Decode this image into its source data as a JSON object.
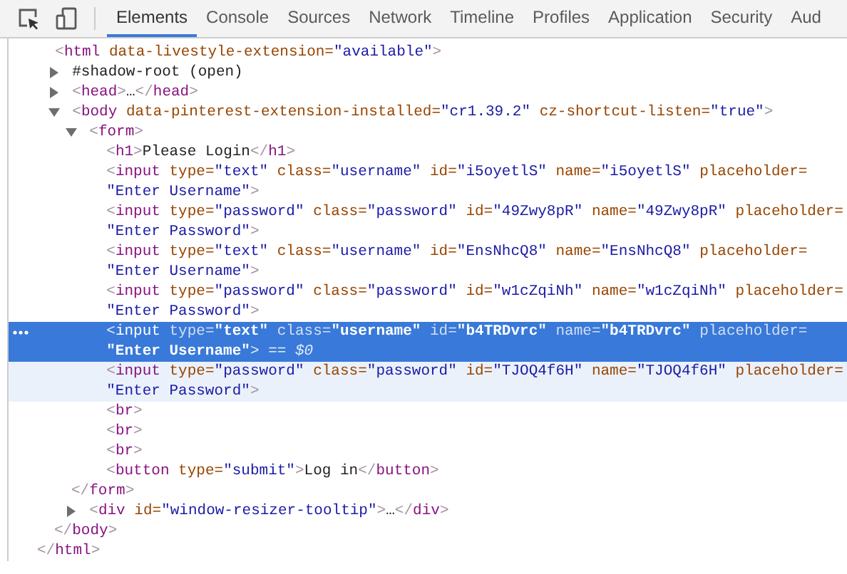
{
  "tabs": [
    {
      "label": "Elements",
      "selected": true
    },
    {
      "label": "Console",
      "selected": false
    },
    {
      "label": "Sources",
      "selected": false
    },
    {
      "label": "Network",
      "selected": false
    },
    {
      "label": "Timeline",
      "selected": false
    },
    {
      "label": "Profiles",
      "selected": false
    },
    {
      "label": "Application",
      "selected": false
    },
    {
      "label": "Security",
      "selected": false
    },
    {
      "label": "Aud",
      "selected": false
    }
  ],
  "tree": [
    {
      "selected": false,
      "hovered": false,
      "lines": [
        [
          {
            "kind": "punct",
            "text": "<"
          },
          {
            "kind": "tag",
            "text": "html"
          },
          {
            "kind": "attr",
            "text": " data-livestyle-extension="
          },
          {
            "kind": "value",
            "text": "\"available\""
          },
          {
            "kind": "punct",
            "text": ">"
          }
        ]
      ],
      "close": [
        {
          "kind": "punct",
          "text": "</"
        },
        {
          "kind": "tag",
          "text": "html"
        },
        {
          "kind": "punct",
          "text": ">"
        }
      ],
      "children": [
        {
          "selected": false,
          "hovered": false,
          "expanded": false,
          "lines": [
            [
              {
                "kind": "text",
                "text": "#shadow-root (open)"
              }
            ]
          ]
        },
        {
          "selected": false,
          "hovered": false,
          "expanded": false,
          "lines": [
            [
              {
                "kind": "punct",
                "text": "<"
              },
              {
                "kind": "tag",
                "text": "head"
              },
              {
                "kind": "punct",
                "text": ">"
              },
              {
                "kind": "text",
                "text": "…"
              },
              {
                "kind": "punct",
                "text": "</"
              },
              {
                "kind": "tag",
                "text": "head"
              },
              {
                "kind": "punct",
                "text": ">"
              }
            ]
          ]
        },
        {
          "selected": false,
          "hovered": false,
          "expanded": true,
          "lines": [
            [
              {
                "kind": "punct",
                "text": "<"
              },
              {
                "kind": "tag",
                "text": "body"
              },
              {
                "kind": "attr",
                "text": " data-pinterest-extension-installed="
              },
              {
                "kind": "value",
                "text": "\"cr1.39.2\""
              },
              {
                "kind": "attr",
                "text": " cz-shortcut-listen="
              },
              {
                "kind": "value",
                "text": "\"true\""
              },
              {
                "kind": "punct",
                "text": ">"
              }
            ]
          ],
          "close": [
            {
              "kind": "punct",
              "text": "</"
            },
            {
              "kind": "tag",
              "text": "body"
            },
            {
              "kind": "punct",
              "text": ">"
            }
          ],
          "children": [
            {
              "selected": false,
              "hovered": false,
              "expanded": true,
              "lines": [
                [
                  {
                    "kind": "punct",
                    "text": "<"
                  },
                  {
                    "kind": "tag",
                    "text": "form"
                  },
                  {
                    "kind": "punct",
                    "text": ">"
                  }
                ]
              ],
              "close": [
                {
                  "kind": "punct",
                  "text": "</"
                },
                {
                  "kind": "tag",
                  "text": "form"
                },
                {
                  "kind": "punct",
                  "text": ">"
                }
              ],
              "children": [
                {
                  "selected": false,
                  "hovered": false,
                  "lines": [
                    [
                      {
                        "kind": "punct",
                        "text": "<"
                      },
                      {
                        "kind": "tag",
                        "text": "h1"
                      },
                      {
                        "kind": "punct",
                        "text": ">"
                      },
                      {
                        "kind": "text",
                        "text": "Please Login"
                      },
                      {
                        "kind": "punct",
                        "text": "</"
                      },
                      {
                        "kind": "tag",
                        "text": "h1"
                      },
                      {
                        "kind": "punct",
                        "text": ">"
                      }
                    ]
                  ]
                },
                {
                  "selected": false,
                  "hovered": false,
                  "lines": [
                    [
                      {
                        "kind": "punct",
                        "text": "<"
                      },
                      {
                        "kind": "tag",
                        "text": "input"
                      },
                      {
                        "kind": "attr",
                        "text": " type="
                      },
                      {
                        "kind": "value",
                        "text": "\"text\""
                      },
                      {
                        "kind": "attr",
                        "text": " class="
                      },
                      {
                        "kind": "value",
                        "text": "\"username\""
                      },
                      {
                        "kind": "attr",
                        "text": " id="
                      },
                      {
                        "kind": "value",
                        "text": "\"i5oyetlS\""
                      },
                      {
                        "kind": "attr",
                        "text": " name="
                      },
                      {
                        "kind": "value",
                        "text": "\"i5oyetlS\""
                      },
                      {
                        "kind": "attr",
                        "text": " placeholder="
                      }
                    ],
                    [
                      {
                        "kind": "value",
                        "text": "\"Enter Username\""
                      },
                      {
                        "kind": "punct",
                        "text": ">"
                      }
                    ]
                  ]
                },
                {
                  "selected": false,
                  "hovered": false,
                  "lines": [
                    [
                      {
                        "kind": "punct",
                        "text": "<"
                      },
                      {
                        "kind": "tag",
                        "text": "input"
                      },
                      {
                        "kind": "attr",
                        "text": " type="
                      },
                      {
                        "kind": "value",
                        "text": "\"password\""
                      },
                      {
                        "kind": "attr",
                        "text": " class="
                      },
                      {
                        "kind": "value",
                        "text": "\"password\""
                      },
                      {
                        "kind": "attr",
                        "text": " id="
                      },
                      {
                        "kind": "value",
                        "text": "\"49Zwy8pR\""
                      },
                      {
                        "kind": "attr",
                        "text": " name="
                      },
                      {
                        "kind": "value",
                        "text": "\"49Zwy8pR\""
                      },
                      {
                        "kind": "attr",
                        "text": " placeholder="
                      }
                    ],
                    [
                      {
                        "kind": "value",
                        "text": "\"Enter Password\""
                      },
                      {
                        "kind": "punct",
                        "text": ">"
                      }
                    ]
                  ]
                },
                {
                  "selected": false,
                  "hovered": false,
                  "lines": [
                    [
                      {
                        "kind": "punct",
                        "text": "<"
                      },
                      {
                        "kind": "tag",
                        "text": "input"
                      },
                      {
                        "kind": "attr",
                        "text": " type="
                      },
                      {
                        "kind": "value",
                        "text": "\"text\""
                      },
                      {
                        "kind": "attr",
                        "text": " class="
                      },
                      {
                        "kind": "value",
                        "text": "\"username\""
                      },
                      {
                        "kind": "attr",
                        "text": " id="
                      },
                      {
                        "kind": "value",
                        "text": "\"EnsNhcQ8\""
                      },
                      {
                        "kind": "attr",
                        "text": " name="
                      },
                      {
                        "kind": "value",
                        "text": "\"EnsNhcQ8\""
                      },
                      {
                        "kind": "attr",
                        "text": " placeholder="
                      }
                    ],
                    [
                      {
                        "kind": "value",
                        "text": "\"Enter Username\""
                      },
                      {
                        "kind": "punct",
                        "text": ">"
                      }
                    ]
                  ]
                },
                {
                  "selected": false,
                  "hovered": false,
                  "lines": [
                    [
                      {
                        "kind": "punct",
                        "text": "<"
                      },
                      {
                        "kind": "tag",
                        "text": "input"
                      },
                      {
                        "kind": "attr",
                        "text": " type="
                      },
                      {
                        "kind": "value",
                        "text": "\"password\""
                      },
                      {
                        "kind": "attr",
                        "text": " class="
                      },
                      {
                        "kind": "value",
                        "text": "\"password\""
                      },
                      {
                        "kind": "attr",
                        "text": " id="
                      },
                      {
                        "kind": "value",
                        "text": "\"w1cZqiNh\""
                      },
                      {
                        "kind": "attr",
                        "text": " name="
                      },
                      {
                        "kind": "value",
                        "text": "\"w1cZqiNh\""
                      },
                      {
                        "kind": "attr",
                        "text": " placeholder="
                      }
                    ],
                    [
                      {
                        "kind": "value",
                        "text": "\"Enter Password\""
                      },
                      {
                        "kind": "punct",
                        "text": ">"
                      }
                    ]
                  ]
                },
                {
                  "selected": true,
                  "hovered": false,
                  "lines": [
                    [
                      {
                        "kind": "punct",
                        "text": "<"
                      },
                      {
                        "kind": "tag",
                        "text": "input"
                      },
                      {
                        "kind": "attr",
                        "text": " type="
                      },
                      {
                        "kind": "value",
                        "text": "\"text\""
                      },
                      {
                        "kind": "attr",
                        "text": " class="
                      },
                      {
                        "kind": "value",
                        "text": "\"username\""
                      },
                      {
                        "kind": "attr",
                        "text": " id="
                      },
                      {
                        "kind": "value",
                        "text": "\"b4TRDvrc\""
                      },
                      {
                        "kind": "attr",
                        "text": " name="
                      },
                      {
                        "kind": "value",
                        "text": "\"b4TRDvrc\""
                      },
                      {
                        "kind": "attr",
                        "text": " placeholder="
                      }
                    ],
                    [
                      {
                        "kind": "value",
                        "text": "\"Enter Username\""
                      },
                      {
                        "kind": "punct",
                        "text": ">"
                      },
                      {
                        "kind": "console",
                        "text": " == $0"
                      }
                    ]
                  ]
                },
                {
                  "selected": false,
                  "hovered": true,
                  "lines": [
                    [
                      {
                        "kind": "punct",
                        "text": "<"
                      },
                      {
                        "kind": "tag",
                        "text": "input"
                      },
                      {
                        "kind": "attr",
                        "text": " type="
                      },
                      {
                        "kind": "value",
                        "text": "\"password\""
                      },
                      {
                        "kind": "attr",
                        "text": " class="
                      },
                      {
                        "kind": "value",
                        "text": "\"password\""
                      },
                      {
                        "kind": "attr",
                        "text": " id="
                      },
                      {
                        "kind": "value",
                        "text": "\"TJOQ4f6H\""
                      },
                      {
                        "kind": "attr",
                        "text": " name="
                      },
                      {
                        "kind": "value",
                        "text": "\"TJOQ4f6H\""
                      },
                      {
                        "kind": "attr",
                        "text": " placeholder="
                      }
                    ],
                    [
                      {
                        "kind": "value",
                        "text": "\"Enter Password\""
                      },
                      {
                        "kind": "punct",
                        "text": ">"
                      }
                    ]
                  ]
                },
                {
                  "selected": false,
                  "hovered": false,
                  "lines": [
                    [
                      {
                        "kind": "punct",
                        "text": "<"
                      },
                      {
                        "kind": "tag",
                        "text": "br"
                      },
                      {
                        "kind": "punct",
                        "text": ">"
                      }
                    ]
                  ]
                },
                {
                  "selected": false,
                  "hovered": false,
                  "lines": [
                    [
                      {
                        "kind": "punct",
                        "text": "<"
                      },
                      {
                        "kind": "tag",
                        "text": "br"
                      },
                      {
                        "kind": "punct",
                        "text": ">"
                      }
                    ]
                  ]
                },
                {
                  "selected": false,
                  "hovered": false,
                  "lines": [
                    [
                      {
                        "kind": "punct",
                        "text": "<"
                      },
                      {
                        "kind": "tag",
                        "text": "br"
                      },
                      {
                        "kind": "punct",
                        "text": ">"
                      }
                    ]
                  ]
                },
                {
                  "selected": false,
                  "hovered": false,
                  "lines": [
                    [
                      {
                        "kind": "punct",
                        "text": "<"
                      },
                      {
                        "kind": "tag",
                        "text": "button"
                      },
                      {
                        "kind": "attr",
                        "text": " type="
                      },
                      {
                        "kind": "value",
                        "text": "\"submit\""
                      },
                      {
                        "kind": "punct",
                        "text": ">"
                      },
                      {
                        "kind": "text",
                        "text": "Log in"
                      },
                      {
                        "kind": "punct",
                        "text": "</"
                      },
                      {
                        "kind": "tag",
                        "text": "button"
                      },
                      {
                        "kind": "punct",
                        "text": ">"
                      }
                    ]
                  ]
                }
              ]
            },
            {
              "selected": false,
              "hovered": false,
              "expanded": false,
              "lines": [
                [
                  {
                    "kind": "punct",
                    "text": "<"
                  },
                  {
                    "kind": "tag",
                    "text": "div"
                  },
                  {
                    "kind": "attr",
                    "text": " id="
                  },
                  {
                    "kind": "value",
                    "text": "\"window-resizer-tooltip\""
                  },
                  {
                    "kind": "punct",
                    "text": ">"
                  },
                  {
                    "kind": "text",
                    "text": "…"
                  },
                  {
                    "kind": "punct",
                    "text": "</"
                  },
                  {
                    "kind": "tag",
                    "text": "div"
                  },
                  {
                    "kind": "punct",
                    "text": ">"
                  }
                ]
              ]
            }
          ]
        }
      ]
    }
  ]
}
